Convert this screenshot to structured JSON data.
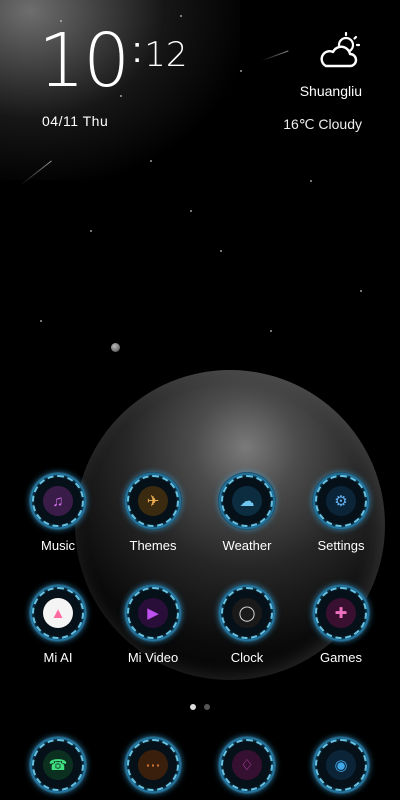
{
  "clock": {
    "hour": "10",
    "separator": ":",
    "minute": "12"
  },
  "date": "04/11  Thu",
  "weather": {
    "city": "Shuangliu",
    "summary": "16℃  Cloudy",
    "icon": "cloudy-sun-icon"
  },
  "apps_row1": [
    {
      "label": "Music",
      "icon": "music-icon",
      "accent": "#c060d8"
    },
    {
      "label": "Themes",
      "icon": "jet-icon",
      "accent": "#e0a040"
    },
    {
      "label": "Weather",
      "icon": "cloud-icon",
      "accent": "#5ab8e8"
    },
    {
      "label": "Settings",
      "icon": "gear-icon",
      "accent": "#4aa0e0"
    }
  ],
  "apps_row2": [
    {
      "label": "Mi AI",
      "icon": "mi-ai-icon",
      "accent": "#ff6aa0"
    },
    {
      "label": "Mi Video",
      "icon": "play-icon",
      "accent": "#b040e0"
    },
    {
      "label": "Clock",
      "icon": "clock-icon",
      "accent": "#cccccc"
    },
    {
      "label": "Games",
      "icon": "gamepad-icon",
      "accent": "#f070c0"
    }
  ],
  "dock": [
    {
      "icon": "phone-icon",
      "accent": "#40e080"
    },
    {
      "icon": "messages-icon",
      "accent": "#ff8a3a"
    },
    {
      "icon": "browser-icon",
      "accent": "#d050c0"
    },
    {
      "icon": "camera-icon",
      "accent": "#40a8e8"
    }
  ],
  "page_indicator": {
    "pages": 2,
    "current": 1
  }
}
